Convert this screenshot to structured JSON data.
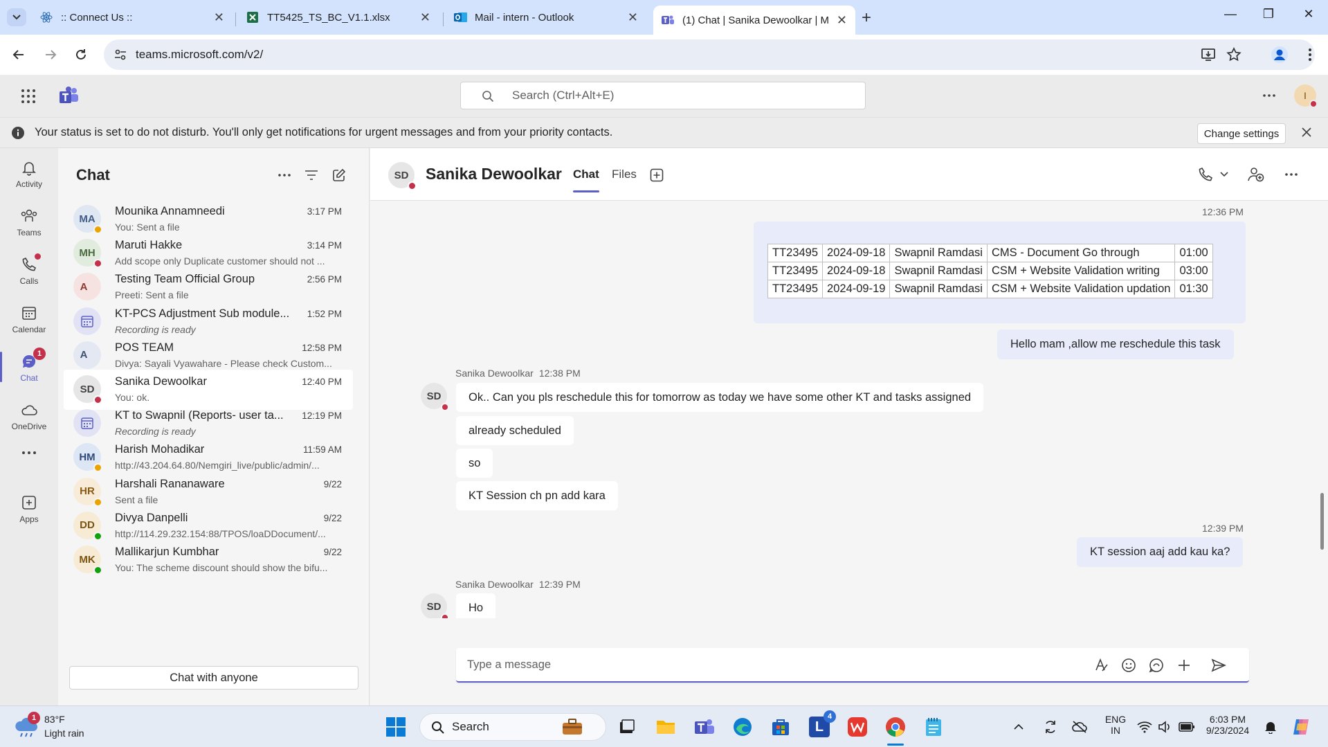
{
  "browser": {
    "tabs": [
      {
        "label": ":: Connect Us ::",
        "icon": "react-icon"
      },
      {
        "label": "TT5425_TS_BC_V1.1.xlsx",
        "icon": "excel-icon"
      },
      {
        "label": "Mail - intern - Outlook",
        "icon": "outlook-icon"
      },
      {
        "label": "(1) Chat | Sanika Dewoolkar | M",
        "icon": "teams-icon",
        "active": true
      }
    ],
    "url": "teams.microsoft.com/v2/"
  },
  "teams": {
    "search_placeholder": "Search (Ctrl+Alt+E)",
    "user_initial": "I"
  },
  "banner": {
    "text": "Your status is set to do not disturb. You'll only get notifications for urgent messages and from your priority contacts.",
    "button": "Change settings"
  },
  "rail": [
    {
      "label": "Activity",
      "icon": "bell-icon"
    },
    {
      "label": "Teams",
      "icon": "teams-people-icon"
    },
    {
      "label": "Calls",
      "icon": "phone-icon"
    },
    {
      "label": "Calendar",
      "icon": "calendar-icon"
    },
    {
      "label": "Chat",
      "icon": "chat-icon",
      "badge": "1"
    },
    {
      "label": "OneDrive",
      "icon": "cloud-icon"
    },
    {
      "label": "Apps",
      "icon": "apps-icon"
    }
  ],
  "chatlist": {
    "title": "Chat",
    "items": [
      {
        "initials": "MA",
        "name": "Mounika Annamneedi",
        "time": "3:17 PM",
        "preview": "You: Sent a file",
        "presence": "away",
        "avbg": "#dfe7f2",
        "avfg": "#3f5d86"
      },
      {
        "initials": "MH",
        "name": "Maruti Hakke",
        "time": "3:14 PM",
        "preview": "Add scope only Duplicate customer should not ...",
        "presence": "dnd",
        "avbg": "#e1ecde",
        "avfg": "#4a6b3f"
      },
      {
        "initials": "A",
        "name": "Testing Team Official Group",
        "time": "2:56 PM",
        "preview": "Preeti: Sent a file",
        "presence": "",
        "avbg": "#f6e3e1",
        "avfg": "#8a3b33"
      },
      {
        "initials": "",
        "name": "KT-PCS Adjustment Sub module...",
        "time": "1:52 PM",
        "preview": "Recording is ready",
        "presence": "",
        "italic": true,
        "meeting": true
      },
      {
        "initials": "A",
        "name": "POS TEAM",
        "time": "12:58 PM",
        "preview": "Divya: Sayali Vyawahare - Please check Custom...",
        "presence": "",
        "avbg": "#e3e8f3",
        "avfg": "#3f4f74"
      },
      {
        "initials": "SD",
        "name": "Sanika Dewoolkar",
        "time": "12:40 PM",
        "preview": "You: ok.",
        "presence": "dnd",
        "avbg": "#e6e6e6",
        "avfg": "#424242",
        "selected": true
      },
      {
        "initials": "",
        "name": "KT to Swapnil (Reports- user ta...",
        "time": "12:19 PM",
        "preview": "Recording is ready",
        "presence": "",
        "italic": true,
        "meeting": true
      },
      {
        "initials": "HM",
        "name": "Harish Mohadikar",
        "time": "11:59 AM",
        "preview": "http://43.204.64.80/Nemgiri_live/public/admin/...",
        "presence": "away",
        "avbg": "#dde6f5",
        "avfg": "#2e4a7a"
      },
      {
        "initials": "HR",
        "name": "Harshali Rananaware",
        "time": "9/22",
        "preview": "Sent a file",
        "presence": "away",
        "avbg": "#f8ecd9",
        "avfg": "#8a5a12"
      },
      {
        "initials": "DD",
        "name": "Divya Danpelli",
        "time": "9/22",
        "preview": "http://114.29.232.154:88/TPOS/loaDDocument/...",
        "presence": "online",
        "avbg": "#f7ebd6",
        "avfg": "#7c5411"
      },
      {
        "initials": "MK",
        "name": "Mallikarjun Kumbhar",
        "time": "9/22",
        "preview": "You: The scheme discount should show the bifu...",
        "presence": "online",
        "avbg": "#f7ebd6",
        "avfg": "#7c5411"
      }
    ],
    "chat_with_anyone": "Chat with anyone"
  },
  "conversation": {
    "initials": "SD",
    "name": "Sanika Dewoolkar",
    "tabs": [
      "Chat",
      "Files"
    ],
    "ts1": "12:36 PM",
    "table": [
      [
        "TT23495",
        "2024-09-18",
        "Swapnil Ramdasi",
        "CMS - Document Go through",
        "01:00"
      ],
      [
        "TT23495",
        "2024-09-18",
        "Swapnil Ramdasi",
        "CSM + Website Validation writing",
        "03:00"
      ],
      [
        "TT23495",
        "2024-09-19",
        "Swapnil Ramdasi",
        "CSM + Website Validation updation",
        "01:30"
      ]
    ],
    "me1": "Hello mam ,allow me reschedule this task",
    "group1": {
      "sender": "Sanika Dewoolkar",
      "time": "12:38 PM",
      "messages": [
        "Ok.. Can you pls reschedule this for tomorrow as today we have some other KT and tasks assigned",
        "already scheduled",
        "so",
        "KT Session ch pn add kara"
      ]
    },
    "ts2": "12:39 PM",
    "me2": "KT session aaj add kau ka?",
    "group2": {
      "sender": "Sanika Dewoolkar",
      "time": "12:39 PM",
      "messages": [
        "Ho"
      ]
    },
    "compose_placeholder": "Type a message"
  },
  "taskbar": {
    "weather_badge": "1",
    "temp": "83°F",
    "condition": "Light rain",
    "search": "Search",
    "lang": "ENG",
    "region": "IN",
    "time": "6:03 PM",
    "date": "9/23/2024",
    "l_badge": "4"
  },
  "colors": {
    "accent": "#5b5fc7",
    "dnd": "#c4314b",
    "away": "#eaa300",
    "online": "#13a10e"
  }
}
